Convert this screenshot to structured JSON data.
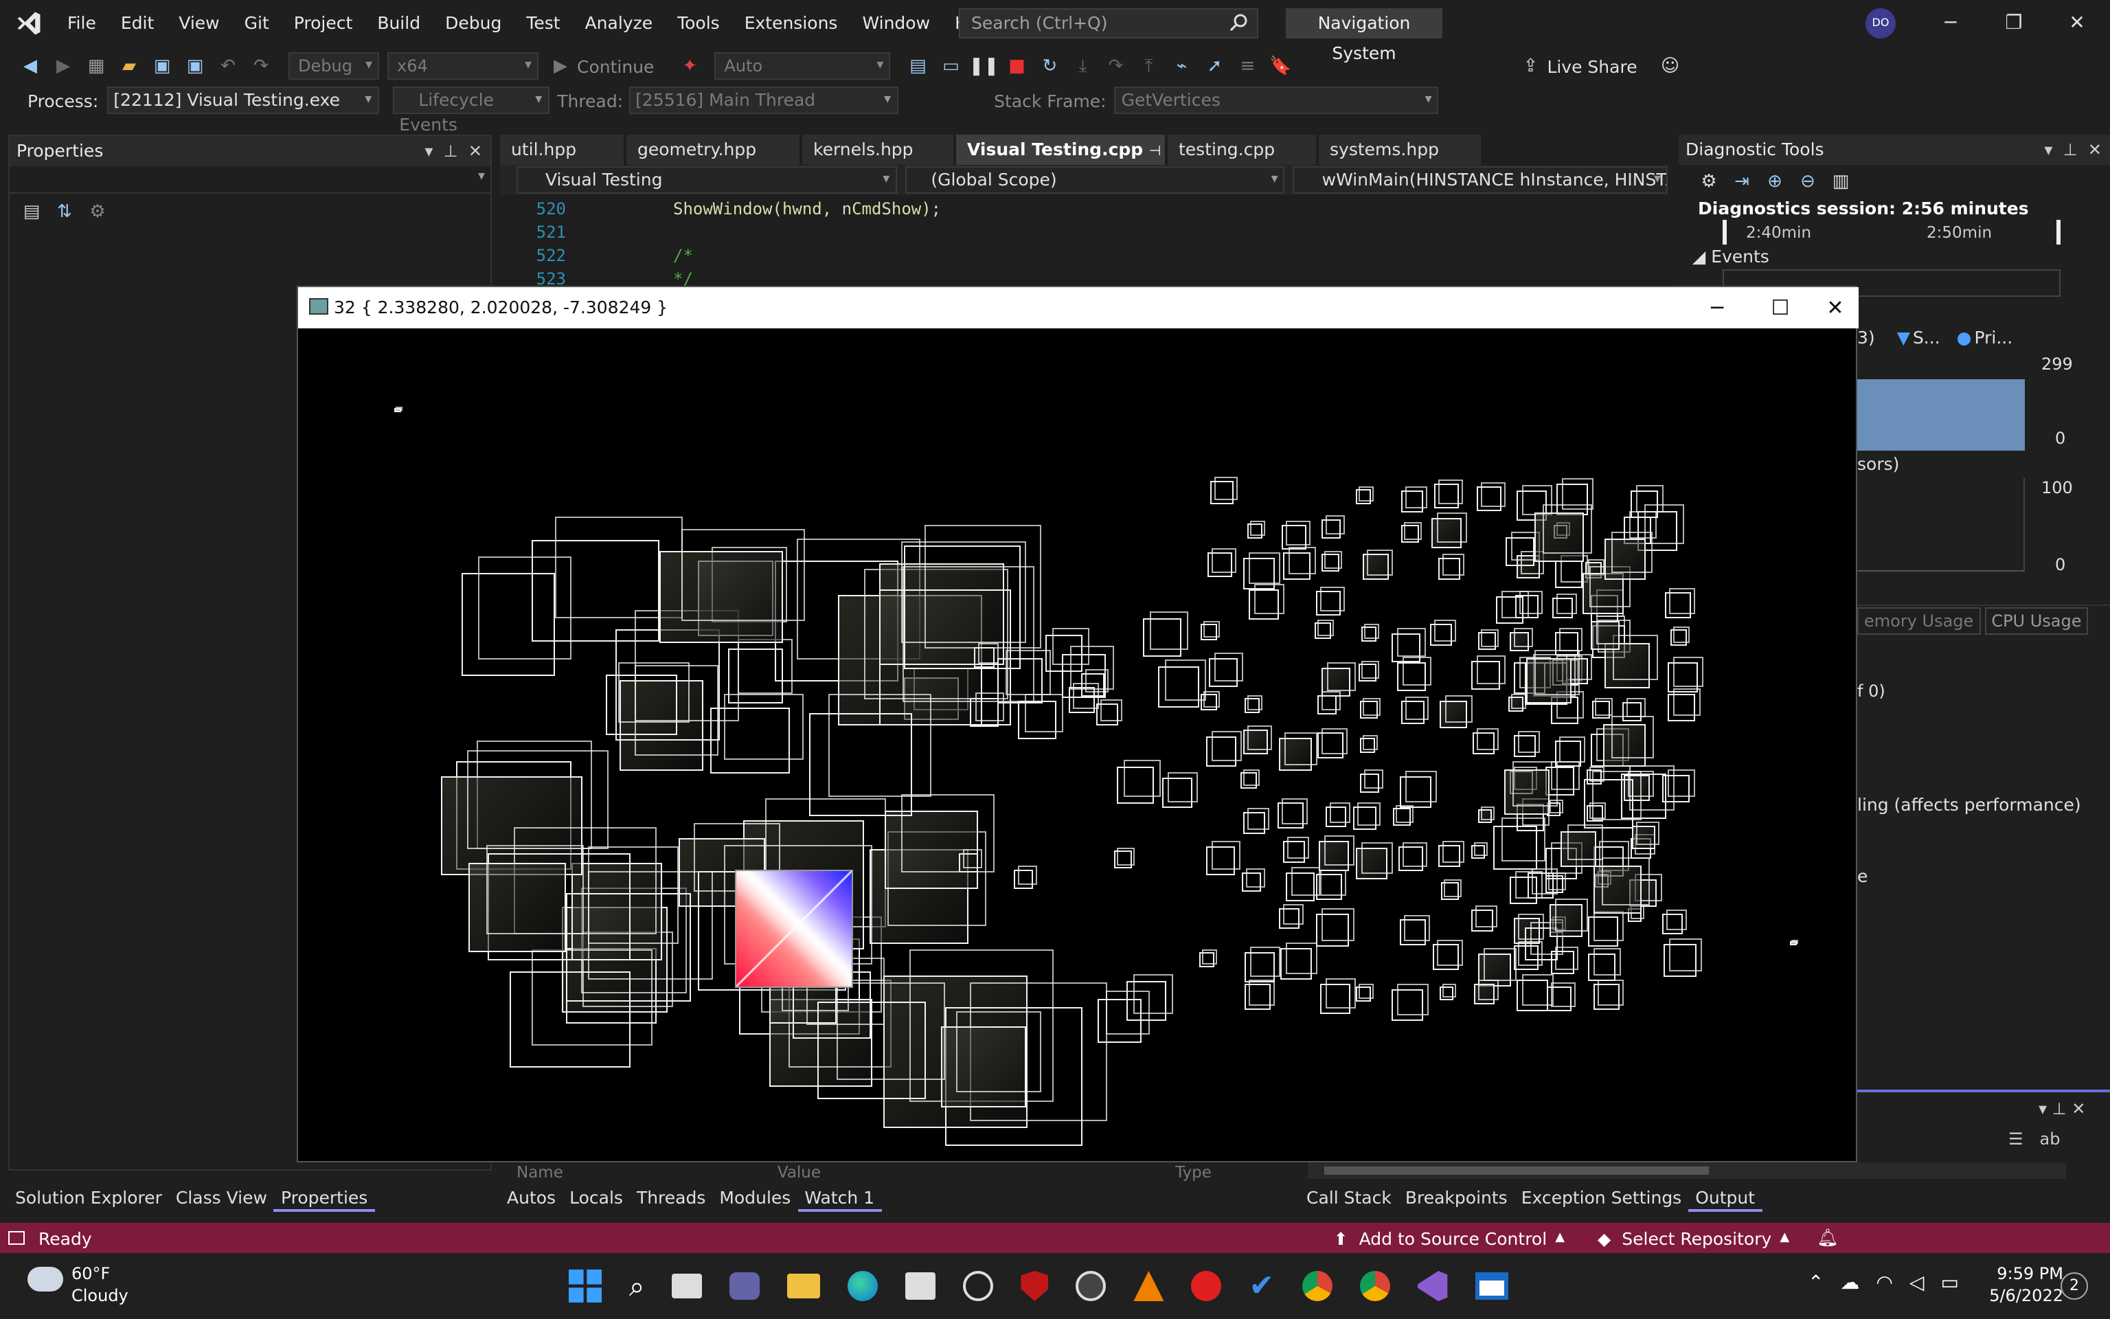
{
  "titlebar": {
    "menu": [
      "File",
      "Edit",
      "View",
      "Git",
      "Project",
      "Build",
      "Debug",
      "Test",
      "Analyze",
      "Tools",
      "Extensions",
      "Window",
      "Help"
    ],
    "search_placeholder": "Search (Ctrl+Q)",
    "solution_name": "Navigation System",
    "avatar_initials": "DO"
  },
  "toolbar": {
    "config": "Debug",
    "platform": "x64",
    "continue_label": "Continue",
    "auto_label": "Auto",
    "live_share_label": "Live Share"
  },
  "locbar": {
    "process_label": "Process:",
    "process_value": "[22112] Visual Testing.exe",
    "lifecycle_label": "Lifecycle Events",
    "thread_label": "Thread:",
    "thread_value": "[25516] Main Thread",
    "stack_label": "Stack Frame:",
    "stack_value": "GetVertices"
  },
  "properties": {
    "title": "Properties"
  },
  "editor": {
    "tabs": [
      "util.hpp",
      "geometry.hpp",
      "kernels.hpp",
      "Visual Testing.cpp",
      "testing.cpp",
      "systems.hpp"
    ],
    "active_tab": "Visual Testing.cpp",
    "nav_project": "Visual Testing",
    "nav_scope": "(Global Scope)",
    "nav_func": "wWinMain(HINSTANCE hInstance, HINSTANC",
    "lines": [
      {
        "n": "520",
        "code": "ShowWindow(hwnd, nCmdShow);"
      },
      {
        "n": "521",
        "code": ""
      },
      {
        "n": "522",
        "code": "/*"
      },
      {
        "n": "523",
        "code": "*/"
      }
    ]
  },
  "diag": {
    "title": "Diagnostic Tools",
    "session": "Diagnostics session: 2:56 minutes",
    "t1": "2:40min",
    "t2": "2:50min",
    "events": "Events",
    "legend_s": "S...",
    "legend_p": "Pri...",
    "legend_paren": "3)",
    "mem_max": "299",
    "mem_min": "0",
    "cpu_label": "sors)",
    "cpu_max": "100",
    "cpu_min": "0",
    "tab_mem": "emory Usage",
    "tab_cpu": "CPU Usage",
    "row_a": "f 0)",
    "row_b": "ling (affects performance)",
    "row_c": "e"
  },
  "watch": {
    "col_name": "Name",
    "col_value": "Value",
    "col_type": "Type"
  },
  "bottom_tabs_left": [
    "Solution Explorer",
    "Class View",
    "Properties"
  ],
  "bottom_tabs_mid": [
    "Autos",
    "Locals",
    "Threads",
    "Modules",
    "Watch 1"
  ],
  "bottom_tabs_right": [
    "Call Stack",
    "Breakpoints",
    "Exception Settings",
    "Output"
  ],
  "status": {
    "ready": "Ready",
    "source_control": "Add to Source Control",
    "repo": "Select Repository"
  },
  "taskbar": {
    "temp": "60°F",
    "weather": "Cloudy",
    "time": "9:59 PM",
    "date": "5/6/2022",
    "notif_count": "2"
  },
  "app_window": {
    "title": "32 { 2.338280, 2.020028, -7.308249 }"
  }
}
